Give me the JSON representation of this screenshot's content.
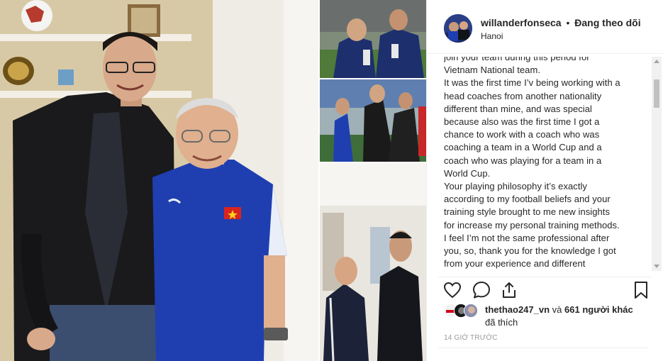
{
  "post": {
    "username": "willanderfonseca",
    "separator": "•",
    "follow_label": "Đang theo dõi",
    "location": "Hanoi",
    "caption_lines": [
      "join your team during this period for",
      "Vietnam National team.",
      "It was the first time I’v being working with a",
      "head coaches from another nationality",
      "different than mine, and was special",
      "because also was the first time I got a",
      "chance to work with a coach who was",
      "coaching a team in a World Cup and a",
      "coach who was playing for a team in a",
      "World Cup.",
      "Your playing philosophy it’s exactly",
      "according to my football beliefs and your",
      "training style brought to me new insights",
      "for increase my personal training methods.",
      "I feel I’m not the same professional after",
      "you, so, thank you for the knowledge I got",
      "from your experience and different"
    ],
    "likes": {
      "liker_name": "thethao247_vn",
      "connector": "và",
      "others": "661 người khác",
      "suffix": "đã thích"
    },
    "timestamp": "14 GIỜ TRƯỚC"
  },
  "icons": {
    "like": "heart-icon",
    "comment": "comment-icon",
    "share": "share-icon",
    "save": "bookmark-icon"
  },
  "colors": {
    "text": "#262626",
    "muted": "#999999",
    "divider": "#efefef",
    "jersey_blue": "#1f3fb0"
  }
}
